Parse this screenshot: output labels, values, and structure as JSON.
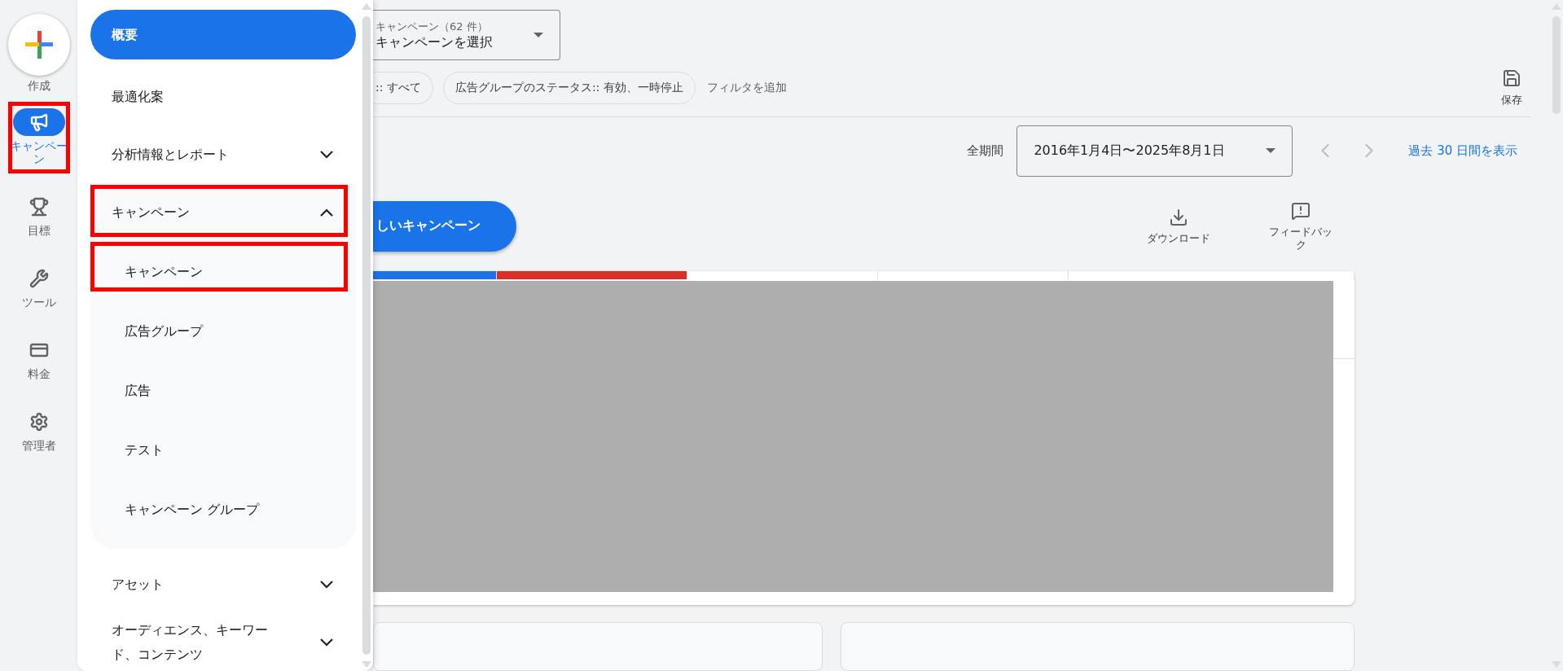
{
  "rail": {
    "create": {
      "label": "作成"
    },
    "items": [
      {
        "label": "キャンペーン",
        "selected": true,
        "highlighted": true
      },
      {
        "label": "目標",
        "selected": false,
        "highlighted": false
      },
      {
        "label": "ツール",
        "selected": false,
        "highlighted": false
      },
      {
        "label": "料金",
        "selected": false,
        "highlighted": false
      },
      {
        "label": "管理者",
        "selected": false,
        "highlighted": false
      }
    ]
  },
  "drawer": {
    "items": [
      {
        "kind": "item",
        "label": "概要",
        "selected": true,
        "highlighted": false
      },
      {
        "kind": "item",
        "label": "最適化案",
        "selected": false,
        "highlighted": false
      },
      {
        "kind": "group",
        "label": "分析情報とレポート",
        "selected": false,
        "expanded": false,
        "highlighted": false
      },
      {
        "kind": "group",
        "label": "キャンペーン",
        "selected": false,
        "expanded": true,
        "highlighted": true,
        "children": [
          {
            "label": "キャンペーン",
            "selected": false,
            "highlighted": true
          },
          {
            "label": "広告グループ",
            "selected": false,
            "highlighted": false
          },
          {
            "label": "広告",
            "selected": false,
            "highlighted": false
          },
          {
            "label": "テスト",
            "selected": false,
            "highlighted": false
          },
          {
            "label": "キャンペーン グループ",
            "selected": false,
            "highlighted": false
          }
        ]
      },
      {
        "kind": "group",
        "label": "アセット",
        "selected": false,
        "expanded": false,
        "highlighted": false
      },
      {
        "kind": "group",
        "label": "オーディエンス、キーワード、コンテンツ",
        "selected": false,
        "expanded": false,
        "highlighted": false
      }
    ]
  },
  "campaign_selector": {
    "label": "キャンペーン（62 件）",
    "value": "キャンペーンを選択"
  },
  "filters": [
    {
      "label": ":: すべて",
      "cut": true
    },
    {
      "label": "広告グループのステータス:: 有効、一時停止",
      "cut": false
    }
  ],
  "add_filter": "フィルタを追加",
  "save": "保存",
  "date_range": {
    "label": "全期間",
    "value": "2016年1月4日〜2025年8月1日"
  },
  "show_last_30": "過去 30 日間を表示",
  "new_campaign": "しいキャンペーン",
  "actions": [
    "ダウンロード",
    "フィードバック"
  ],
  "metric_tabs": [
    {
      "color": "#1a73e8"
    },
    {
      "color": "#d93025"
    },
    {
      "color": "#ffffff"
    },
    {
      "color": "#ffffff"
    },
    {
      "color": "#ffffff"
    }
  ]
}
